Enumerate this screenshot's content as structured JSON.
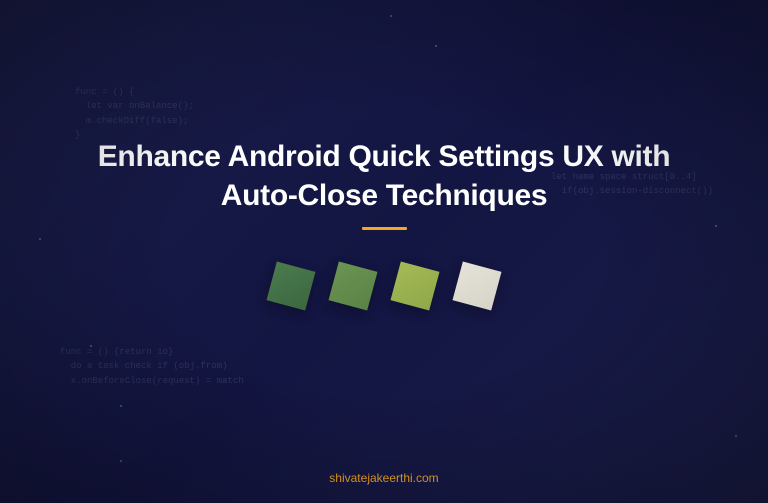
{
  "title": "Enhance Android Quick Settings UX with Auto-Close Techniques",
  "footer_text": "shivatejakeerthi.com",
  "accent_color": "#f5a623",
  "tiles": [
    "#4a7c4e",
    "#6b9553",
    "#a5b956",
    "#e5e3d8"
  ]
}
